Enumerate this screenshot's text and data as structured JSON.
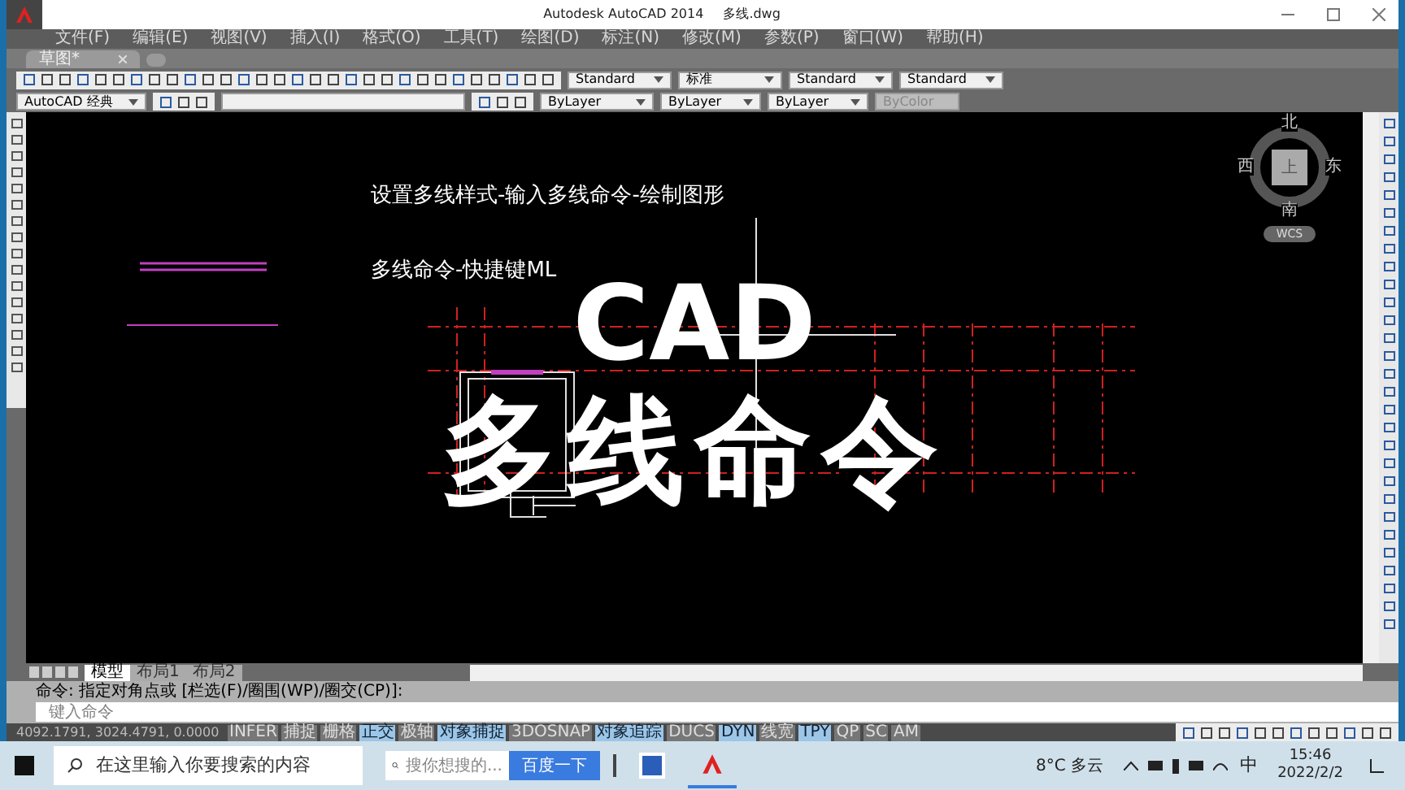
{
  "title_bar": {
    "app_title": "Autodesk AutoCAD 2014",
    "file_name": "多线.dwg"
  },
  "menu": [
    "文件(F)",
    "编辑(E)",
    "视图(V)",
    "插入(I)",
    "格式(O)",
    "工具(T)",
    "绘图(D)",
    "标注(N)",
    "修改(M)",
    "参数(P)",
    "窗口(W)",
    "帮助(H)"
  ],
  "file_tabs": [
    {
      "label": "草图*",
      "selected": true
    }
  ],
  "styles_toolbar": {
    "text_style": "Standard",
    "dim_style": "标准",
    "table_style": "Standard",
    "multileader_style": "Standard"
  },
  "properties_toolbar": {
    "workspace": "AutoCAD 经典",
    "layer_color": "ByLayer",
    "linetype": "ByLayer",
    "lineweight": "ByLayer",
    "plot_style": "ByColor"
  },
  "canvas": {
    "notes": [
      "设置多线样式-输入多线命令-绘制图形",
      "多线命令-快捷键ML"
    ],
    "overlay_title": [
      "CAD",
      "多线命令"
    ],
    "viewcube": {
      "north": "北",
      "west": "西",
      "east": "东",
      "south": "南",
      "top": "上",
      "coordinate_system": "WCS"
    }
  },
  "layout_tabs": [
    {
      "label": "模型",
      "selected": true
    },
    {
      "label": "布局1",
      "selected": false
    },
    {
      "label": "布局2",
      "selected": false
    }
  ],
  "command_line": {
    "history": "命令: 指定对角点或 [栏选(F)/圈围(WP)/圈交(CP)]:",
    "placeholder": "键入命令"
  },
  "status_bar": {
    "coordinates": "4092.1791, 3024.4791, 0.0000",
    "toggles": [
      {
        "label": "INFER",
        "on": false
      },
      {
        "label": "捕捉",
        "on": false
      },
      {
        "label": "栅格",
        "on": false
      },
      {
        "label": "正交",
        "on": true
      },
      {
        "label": "极轴",
        "on": false
      },
      {
        "label": "对象捕捉",
        "on": true
      },
      {
        "label": "3DOSNAP",
        "on": false
      },
      {
        "label": "对象追踪",
        "on": true
      },
      {
        "label": "DUCS",
        "on": false
      },
      {
        "label": "DYN",
        "on": true
      },
      {
        "label": "线宽",
        "on": false
      },
      {
        "label": "TPY",
        "on": true
      },
      {
        "label": "QP",
        "on": false
      },
      {
        "label": "SC",
        "on": false
      },
      {
        "label": "AM",
        "on": false
      }
    ]
  },
  "taskbar": {
    "search_placeholder": "在这里输入你要搜索的内容",
    "web_search_placeholder": "搜你想搜的...",
    "web_search_button": "百度一下",
    "weather": "8°C 多云",
    "ime": "中",
    "time": "15:46",
    "date": "2022/2/2"
  }
}
